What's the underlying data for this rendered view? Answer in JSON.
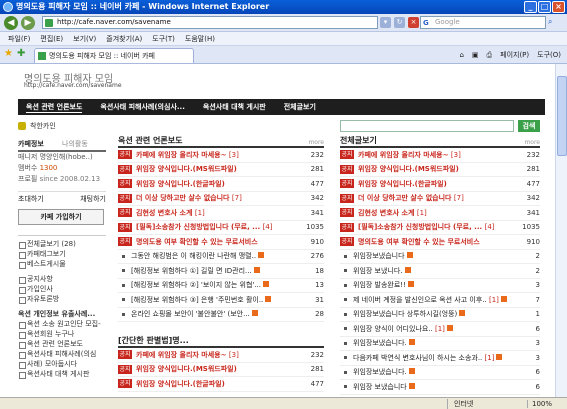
{
  "window": {
    "title": "명의도용 피해자 모임 :: 네이버 카페 - Windows Internet Explorer"
  },
  "address": {
    "url": "http://cafe.naver.com/savename",
    "search_placeholder": "Google"
  },
  "menu": [
    "파일(F)",
    "편집(E)",
    "보기(V)",
    "즐겨찾기(A)",
    "도구(T)",
    "도움말(H)"
  ],
  "tab": {
    "label": "명의도용 피해자 모임 :: 네이버 카페"
  },
  "tabbar_right": [
    "페이지(P)",
    "도구(O)"
  ],
  "cafe": {
    "title": "명의도용 피해자 모임",
    "url": "http://cafe.naver.com/savename"
  },
  "topmenu": [
    "옥션 관련 언론보도",
    "옥션사태 피해사례(의심사...",
    "옥션사태 대책 게시판",
    "전체글보기"
  ],
  "left": {
    "sarak": "착한카인",
    "tabs": [
      "카페정보",
      "나의활동"
    ],
    "manager_label": "매니저",
    "manager_value": "명양인해(hobe..)",
    "members_label": "멤버수",
    "members_value": "1300",
    "since_label": "프로필",
    "since_value": "since 2008.02.13",
    "invite": "초대하기",
    "chat": "채팅하기",
    "join": "카페 가입하기",
    "list1": [
      "전체글보기 (28)",
      "카페태그보기",
      "베스트게시물"
    ],
    "list2": [
      "공지사항",
      "가입인사",
      "자유토론방"
    ],
    "section_head": "옥션 개인정보 유출사례...",
    "list3": [
      "옥션 소송 원고인단 모집-",
      "옥션회원 누구나",
      "옥션 관련 언론보도",
      "옥션사태 피해사례(의심",
      "사례) 모아둡시다",
      "옥션사태 대책 게시판"
    ]
  },
  "search_button": "검색",
  "col1": {
    "head": "옥션 관련 언론보도",
    "more": "more",
    "rows": [
      {
        "tag": "공지",
        "title": "카페에 위임장 올리자 마세용~",
        "cnt": "[3]",
        "num": "232"
      },
      {
        "tag": "공지",
        "title": "위임장 양식입니다.(MS워드파일)",
        "cnt": "",
        "num": "281"
      },
      {
        "tag": "공지",
        "title": "위임장 양식입니다.(한글파일)",
        "cnt": "",
        "num": "477"
      },
      {
        "tag": "공지",
        "title": "더 이상 당하고만 살수 없습니다",
        "cnt": "[7]",
        "num": "342"
      },
      {
        "tag": "공지",
        "title": "김현성 변호사 소계",
        "cnt": "[1]",
        "num": "341"
      },
      {
        "tag": "공지",
        "title": "[필독]소송참가 신청방법입니다 (무료, ...",
        "cnt": "[4]",
        "num": "1035"
      },
      {
        "tag": "공지",
        "title": "명의도용 여부 확인할 수 있는 무료서비스",
        "cnt": "",
        "num": "910"
      },
      {
        "tag": "",
        "title": "그동안 해킹범은 이 해킹이란 나란해 맹렬..",
        "cnt": "",
        "num": "276"
      },
      {
        "tag": "",
        "title": "[해킹정보 위험하다 ①] 길릴 면 ID관리...",
        "cnt": "",
        "num": "18"
      },
      {
        "tag": "",
        "title": "[해킹정보 위험하다 ②] '보이지 않는 위협'...",
        "cnt": "",
        "num": "13"
      },
      {
        "tag": "",
        "title": "[해킹정보 위험하다 ③] 은행 '주민번호 활이..",
        "cnt": "",
        "num": "31"
      },
      {
        "tag": "",
        "title": "온라인 쇼핑몰 보안이 '불안불안' (보안...",
        "cnt": "",
        "num": "28"
      }
    ],
    "head2": "[간단한 판별법]명...",
    "rows2": [
      {
        "tag": "공지",
        "title": "카페에 위임장 올리자 마세용~",
        "cnt": "[3]",
        "num": "232"
      },
      {
        "tag": "공지",
        "title": "위임장 양식입니다.(MS워드파일)",
        "cnt": "",
        "num": "281"
      },
      {
        "tag": "공지",
        "title": "위임장 양식입니다.(한글파일)",
        "cnt": "",
        "num": "477"
      }
    ]
  },
  "col2": {
    "head": "전체글보기",
    "more": "more",
    "rows": [
      {
        "tag": "공지",
        "title": "카페에 위임장 올리자 마세용~",
        "cnt": "[3]",
        "num": "232"
      },
      {
        "tag": "공지",
        "title": "위임장 양식입니다.(MS워드파일)",
        "cnt": "",
        "num": "281"
      },
      {
        "tag": "공지",
        "title": "위임장 양식입니다.(한글파일)",
        "cnt": "",
        "num": "477"
      },
      {
        "tag": "공지",
        "title": "더 이상 당하고만 살수 없습니다",
        "cnt": "[7]",
        "num": "342"
      },
      {
        "tag": "공지",
        "title": "김현성 변호사 소계",
        "cnt": "[1]",
        "num": "341"
      },
      {
        "tag": "공지",
        "title": "[필독]소송참가 신청방법입니다 (무료, ...",
        "cnt": "[4]",
        "num": "1035"
      },
      {
        "tag": "공지",
        "title": "명의도용 여부 확인할 수 있는 무료서비스",
        "cnt": "",
        "num": "910"
      },
      {
        "tag": "",
        "title": "위임장보냈습니다",
        "cnt": "",
        "num": "2"
      },
      {
        "tag": "",
        "title": "위임장 보냈니다.",
        "cnt": "",
        "num": "2"
      },
      {
        "tag": "",
        "title": "위임장 발송완료!!",
        "cnt": "",
        "num": "3"
      },
      {
        "tag": "",
        "title": "제 네이버 계정을 발신인으로 옥션 사고 이후..",
        "cnt": "[1]",
        "num": "7"
      },
      {
        "tag": "",
        "title": "위임장보냈습니다 상투하시길(엉뚱)",
        "cnt": "",
        "num": "1"
      },
      {
        "tag": "",
        "title": "위임장 양식이 어디있나요..",
        "cnt": "[1]",
        "num": "6"
      },
      {
        "tag": "",
        "title": "위임장보냈습니다.",
        "cnt": "",
        "num": "3"
      },
      {
        "tag": "",
        "title": "다음카페 박연식 변호사님이 하시는 소송과..",
        "cnt": "[1]",
        "num": "3"
      },
      {
        "tag": "",
        "title": "위임장보냈습니다.",
        "cnt": "",
        "num": "6"
      },
      {
        "tag": "",
        "title": "위임장 보냈습니다",
        "cnt": "",
        "num": "6"
      }
    ]
  },
  "status": {
    "zone": "인터넷",
    "zoom": "100%"
  }
}
